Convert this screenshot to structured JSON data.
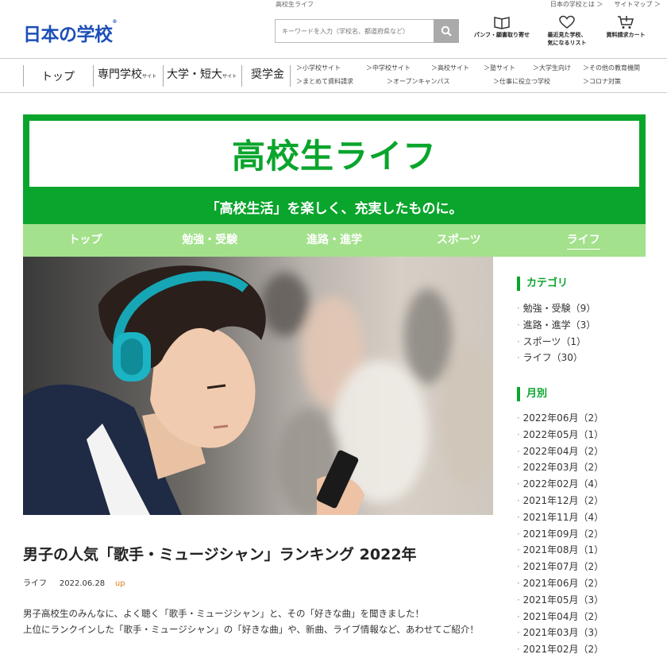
{
  "header": {
    "tagline": "高校生ライフ",
    "top_links": [
      "日本の学校とは ＞",
      "サイトマップ ＞"
    ],
    "logo": "日本の学校",
    "search_placeholder": "キーワードを入力（学校名、都道府県など）",
    "icons": [
      {
        "label1": "パンフ・願書取り寄せ",
        "label2": "",
        "icon": "book-icon"
      },
      {
        "label1": "最近見た学校、",
        "label2": "気になるリスト",
        "icon": "heart-icon"
      },
      {
        "label1": "資料請求カート",
        "label2": "",
        "icon": "cart-icon"
      }
    ]
  },
  "nav": {
    "main": [
      {
        "label": "トップ",
        "small": ""
      },
      {
        "label": "専門学校",
        "small": "サイト"
      },
      {
        "label": "大学・短大",
        "small": "サイト"
      },
      {
        "label": "奨学金",
        "small": ""
      }
    ],
    "sub_row1": [
      "＞小学校サイト",
      "＞中学校サイト",
      "＞高校サイト",
      "＞塾サイト",
      "＞大学生向け",
      "＞その他の教育機関"
    ],
    "sub_row2": [
      "＞まとめて資料請求",
      "＞オープンキャンパス",
      "＞仕事に役立つ学校",
      "＞コロナ対策"
    ]
  },
  "banner": {
    "title": "高校生ライフ",
    "subtitle": "「高校生活」を楽しく、充実したものに。",
    "tabs": [
      {
        "label": "トップ",
        "active": false
      },
      {
        "label": "勉強・受験",
        "active": false
      },
      {
        "label": "進路・進学",
        "active": false
      },
      {
        "label": "スポーツ",
        "active": false
      },
      {
        "label": "ライフ",
        "active": true
      }
    ]
  },
  "article": {
    "title": "男子の人気「歌手・ミュージシャン」ランキング 2022年",
    "category": "ライフ",
    "date": "2022.06.28",
    "badge": "up",
    "paragraph1": "男子高校生のみんなに、よく聴く「歌手・ミュージシャン」と、その「好きな曲」を聞きました！",
    "paragraph2": "上位にランクインした「歌手・ミュージシャン」の「好きな曲」や、新曲、ライブ情報など、あわせてご紹介！"
  },
  "sidebar": {
    "category_heading": "カテゴリ",
    "categories": [
      "勉強・受験（9）",
      "進路・進学（3）",
      "スポーツ（1）",
      "ライフ（30）"
    ],
    "monthly_heading": "月別",
    "months": [
      "2022年06月（2）",
      "2022年05月（1）",
      "2022年04月（2）",
      "2022年03月（2）",
      "2022年02月（4）",
      "2021年12月（2）",
      "2021年11月（4）",
      "2021年09月（2）",
      "2021年08月（1）",
      "2021年07月（2）",
      "2021年06月（2）",
      "2021年05月（3）",
      "2021年04月（2）",
      "2021年03月（3）",
      "2021年02月（2）"
    ]
  },
  "colors": {
    "brand_green": "#0aa52c",
    "tab_green": "#a3e18c",
    "logo_blue": "#1d4fb8",
    "up_orange": "#e07b1f"
  }
}
